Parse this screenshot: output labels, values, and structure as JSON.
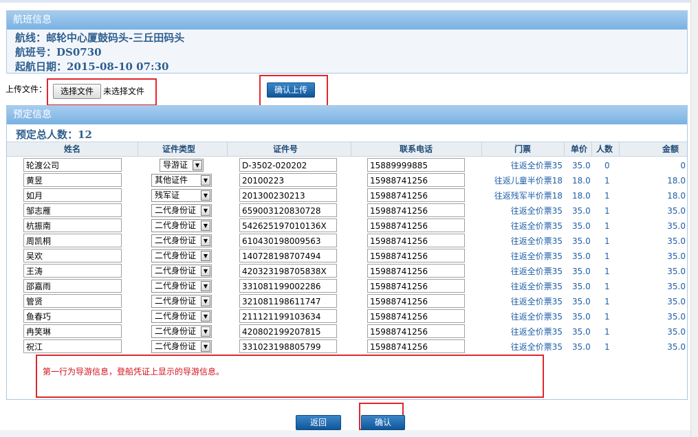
{
  "flight": {
    "header": "航班信息",
    "route": "航线：邮轮中心厦鼓码头-三丘田码头",
    "flight_no": "航班号：DS0730",
    "departure": "起航日期：2015-08-10 07:30"
  },
  "upload": {
    "label": "上传文件：",
    "choose_button": "选择文件",
    "no_file": "未选择文件",
    "confirm_upload": "确认上传"
  },
  "booking": {
    "header": "预定信息",
    "total": "预定总人数：12",
    "columns": [
      "姓名",
      "证件类型",
      "证件号",
      "联系电话",
      "门票",
      "单价",
      "人数",
      "金额"
    ],
    "rows": [
      {
        "name": "轮渡公司",
        "id_type": "导游证",
        "id_no": "D-3502-020202",
        "phone": "15889999885",
        "ticket": "往返全价票35",
        "price": "35.0",
        "count": "0",
        "amount": "0"
      },
      {
        "name": "黄昱",
        "id_type": "其他证件",
        "id_no": "20100223",
        "phone": "15988741256",
        "ticket": "往返儿童半价票18",
        "price": "18.0",
        "count": "1",
        "amount": "18.0"
      },
      {
        "name": "如月",
        "id_type": "残军证",
        "id_no": "201300230213",
        "phone": "15988741256",
        "ticket": "往返残军半价票18",
        "price": "18.0",
        "count": "1",
        "amount": "18.0"
      },
      {
        "name": "邹志雁",
        "id_type": "二代身份证",
        "id_no": "659003120830728",
        "phone": "15988741256",
        "ticket": "往返全价票35",
        "price": "35.0",
        "count": "1",
        "amount": "35.0"
      },
      {
        "name": "杭振南",
        "id_type": "二代身份证",
        "id_no": "542625197010136X",
        "phone": "15988741256",
        "ticket": "往返全价票35",
        "price": "35.0",
        "count": "1",
        "amount": "35.0"
      },
      {
        "name": "周凯桐",
        "id_type": "二代身份证",
        "id_no": "610430198009563",
        "phone": "15988741256",
        "ticket": "往返全价票35",
        "price": "35.0",
        "count": "1",
        "amount": "35.0"
      },
      {
        "name": "吴欢",
        "id_type": "二代身份证",
        "id_no": "140728198707494",
        "phone": "15988741256",
        "ticket": "往返全价票35",
        "price": "35.0",
        "count": "1",
        "amount": "35.0"
      },
      {
        "name": "王涛",
        "id_type": "二代身份证",
        "id_no": "420323198705838X",
        "phone": "15988741256",
        "ticket": "往返全价票35",
        "price": "35.0",
        "count": "1",
        "amount": "35.0"
      },
      {
        "name": "邵嘉雨",
        "id_type": "二代身份证",
        "id_no": "331081199002286",
        "phone": "15988741256",
        "ticket": "往返全价票35",
        "price": "35.0",
        "count": "1",
        "amount": "35.0"
      },
      {
        "name": "管贤",
        "id_type": "二代身份证",
        "id_no": "321081198611747",
        "phone": "15988741256",
        "ticket": "往返全价票35",
        "price": "35.0",
        "count": "1",
        "amount": "35.0"
      },
      {
        "name": "鱼春巧",
        "id_type": "二代身份证",
        "id_no": "211121199103634",
        "phone": "15988741256",
        "ticket": "往返全价票35",
        "price": "35.0",
        "count": "1",
        "amount": "35.0"
      },
      {
        "name": "冉笑琳",
        "id_type": "二代身份证",
        "id_no": "420802199207815",
        "phone": "15988741256",
        "ticket": "往返全价票35",
        "price": "35.0",
        "count": "1",
        "amount": "35.0"
      },
      {
        "name": "祝江",
        "id_type": "二代身份证",
        "id_no": "331023198805799",
        "phone": "15988741256",
        "ticket": "往返全价票35",
        "price": "35.0",
        "count": "1",
        "amount": "35.0"
      }
    ]
  },
  "note": "第一行为导游信息，登船凭证上显示的导游信息。",
  "actions": {
    "back": "返回",
    "confirm": "确认"
  }
}
